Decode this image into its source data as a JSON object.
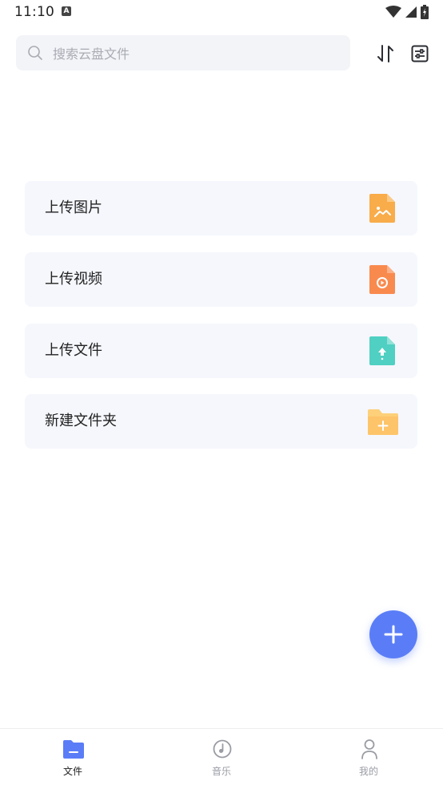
{
  "status": {
    "time": "11:10",
    "indicator_letter": "A"
  },
  "search": {
    "placeholder": "搜索云盘文件",
    "value": ""
  },
  "toolbar": {
    "sort_icon": "sort-icon",
    "filter_icon": "filter-settings-icon"
  },
  "actions": [
    {
      "label": "上传图片",
      "icon": "image-file-icon",
      "color": "#f9ac4a"
    },
    {
      "label": "上传视频",
      "icon": "video-file-icon",
      "color": "#f98a4e"
    },
    {
      "label": "上传文件",
      "icon": "upload-file-icon",
      "color": "#4fd0c2"
    },
    {
      "label": "新建文件夹",
      "icon": "new-folder-icon",
      "color": "#fdd079"
    }
  ],
  "fab": {
    "icon": "plus-icon",
    "color": "#5a7df7"
  },
  "bottom_nav": {
    "items": [
      {
        "label": "文件",
        "icon": "folder-icon",
        "active": true
      },
      {
        "label": "音乐",
        "icon": "music-disc-icon",
        "active": false
      },
      {
        "label": "我的",
        "icon": "user-icon",
        "active": false
      }
    ],
    "active_color": "#5a7df7",
    "inactive_color": "#9a9ca4"
  }
}
